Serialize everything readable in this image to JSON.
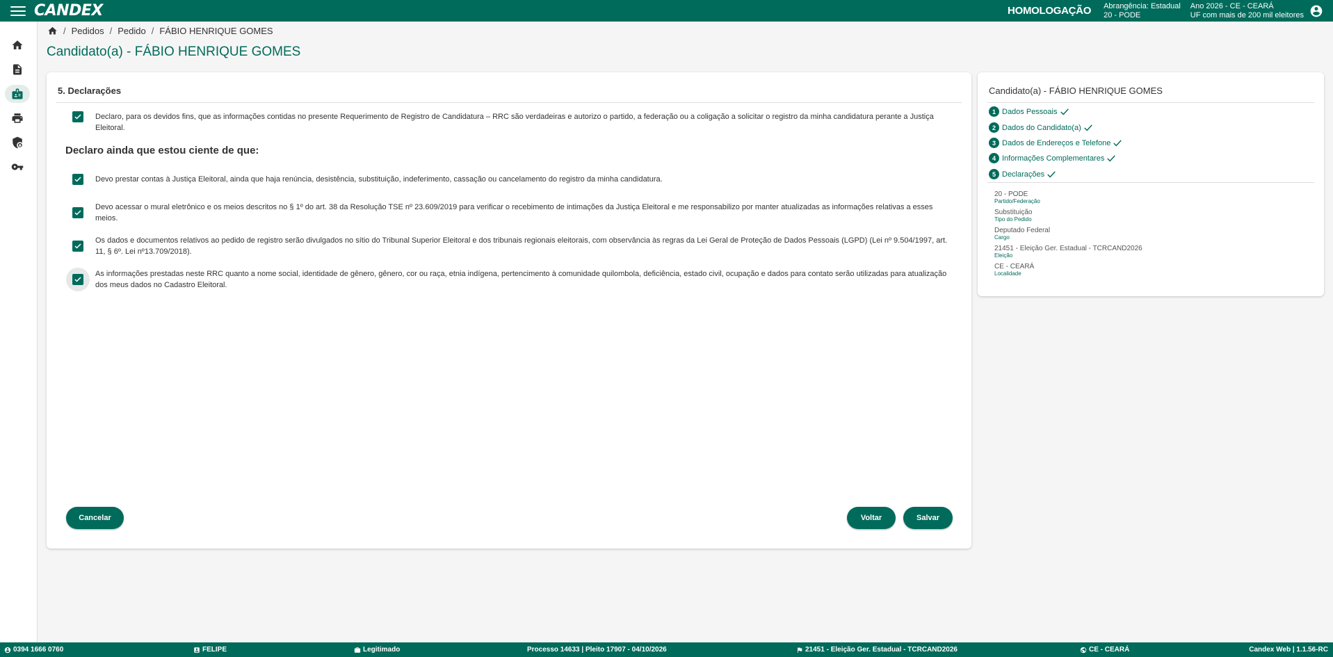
{
  "header": {
    "logo": "CANDEX",
    "environment": "HOMOLOGAÇÃO",
    "abrangencia_line1": "Abrangência: Estadual",
    "abrangencia_line2": "20 - PODE",
    "ano_line1": "Ano 2026 - CE - CEARÁ",
    "ano_line2": "UF com mais de 200 mil eleitores"
  },
  "sidebar": {
    "items": [
      {
        "icon": "home-icon"
      },
      {
        "icon": "document-icon"
      },
      {
        "icon": "id-badge-icon",
        "active": true
      },
      {
        "icon": "printer-icon"
      },
      {
        "icon": "shield-lock-icon"
      },
      {
        "icon": "key-icon"
      }
    ]
  },
  "breadcrumb": {
    "items": [
      "Pedidos",
      "Pedido",
      "FÁBIO HENRIQUE GOMES"
    ]
  },
  "page_title": "Candidato(a) - FÁBIO HENRIQUE GOMES",
  "form": {
    "section_title": "5. Declarações",
    "declaration_main": "Declaro, para os devidos fins, que as informações contidas no presente Requerimento de Registro de Candidatura – RRC são verdadeiras e autorizo o partido, a federação ou a coligação a solicitar o registro da minha candidatura perante a Justiça Eleitoral.",
    "subheading": "Declaro ainda que estou ciente de que:",
    "declarations": [
      "Devo prestar contas à Justiça Eleitoral, ainda que haja renúncia, desistência, substituição, indeferimento, cassação ou cancelamento do registro da minha candidatura.",
      "Devo acessar o mural eletrônico e os meios descritos no § 1º do art. 38 da Resolução TSE nº 23.609/2019 para verificar o recebimento de intimações da Justiça Eleitoral e me responsabilizo por manter atualizadas as informações relativas a esses meios.",
      "Os dados e documentos relativos ao pedido de registro serão divulgados no sítio do Tribunal Superior Eleitoral e dos tribunais regionais eleitorais, com observância às regras da Lei Geral de Proteção de Dados Pessoais (LGPD) (Lei nº 9.504/1997, art. 11, § 6º. Lei nº13.709/2018).",
      "As informações prestadas neste RRC quanto a nome social, identidade de gênero, gênero, cor ou raça, etnia indígena, pertencimento à comunidade quilombola, deficiência, estado civil, ocupação e dados para contato serão utilizadas para atualização dos meus dados no Cadastro Eleitoral."
    ],
    "buttons": {
      "cancel": "Cancelar",
      "back": "Voltar",
      "save": "Salvar"
    }
  },
  "summary": {
    "title": "Candidato(a) - FÁBIO HENRIQUE GOMES",
    "steps": [
      {
        "num": "1",
        "label": "Dados Pessoais"
      },
      {
        "num": "2",
        "label": "Dados do Candidato(a)"
      },
      {
        "num": "3",
        "label": "Dados de Endereços e Telefone"
      },
      {
        "num": "4",
        "label": "Informações Complementares"
      },
      {
        "num": "5",
        "label": "Declarações"
      }
    ],
    "info": [
      {
        "value": "20 - PODE",
        "label": "Partido/Federação"
      },
      {
        "value": "Substituição",
        "label": "Tipo do Pedido"
      },
      {
        "value": "Deputado Federal",
        "label": "Cargo"
      },
      {
        "value": "21451 - Eleição Ger. Estadual - TCRCAND2026",
        "label": "Eleição"
      },
      {
        "value": "CE - CEARÁ",
        "label": "Localidade"
      }
    ]
  },
  "footer": {
    "phone": "0394 1666 0760",
    "user": "FELIPE",
    "status": "Legitimado",
    "processo": "Processo 14633 | Pleito 17907 - 04/10/2026",
    "eleicao": "21451 - Eleição Ger. Estadual - TCRCAND2026",
    "localidade": "CE - CEARÁ",
    "version": "Candex Web | 1.1.56-RC"
  },
  "colors": {
    "primary": "#006b5b",
    "background": "#f5f5f5"
  }
}
